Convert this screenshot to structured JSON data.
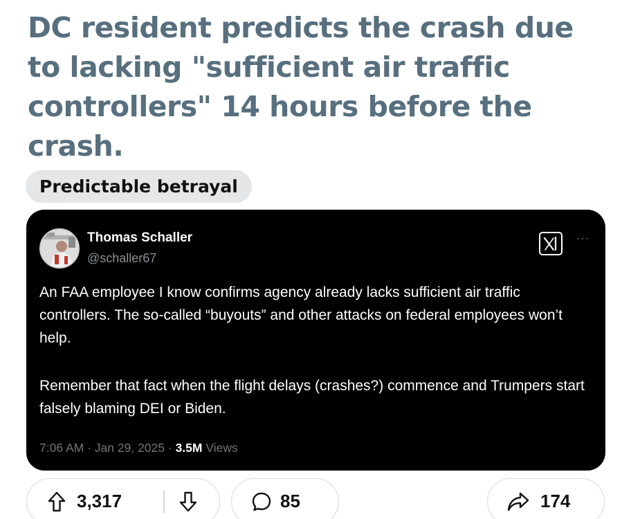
{
  "post": {
    "title": "DC resident predicts the crash due to lacking \"sufficient air traffic controllers\" 14 hours before the crash.",
    "flair": "Predictable betrayal"
  },
  "tweet": {
    "author_name": "Thomas Schaller",
    "author_handle": "@schaller67",
    "paragraph_1": "An FAA employee I know confirms agency already lacks sufficient air traffic controllers. The so-called “buyouts” and other attacks on federal employees won’t help.",
    "paragraph_2": "Remember that fact when the flight delays (crashes?) commence and Trumpers start falsely blaming DEI or Biden.",
    "time": "7:06 AM",
    "date": "Jan 29, 2025",
    "separator": "·",
    "views_count": "3.5M",
    "views_label": "Views",
    "more_icon": "···"
  },
  "actions": {
    "upvotes": "3,317",
    "comments": "85",
    "shares": "174"
  },
  "colors": {
    "title": "#576f7e",
    "flair_bg": "#e4e6e8",
    "card_bg": "#000000",
    "meta_gray": "#71767b",
    "pill_border": "#d5d8db"
  }
}
